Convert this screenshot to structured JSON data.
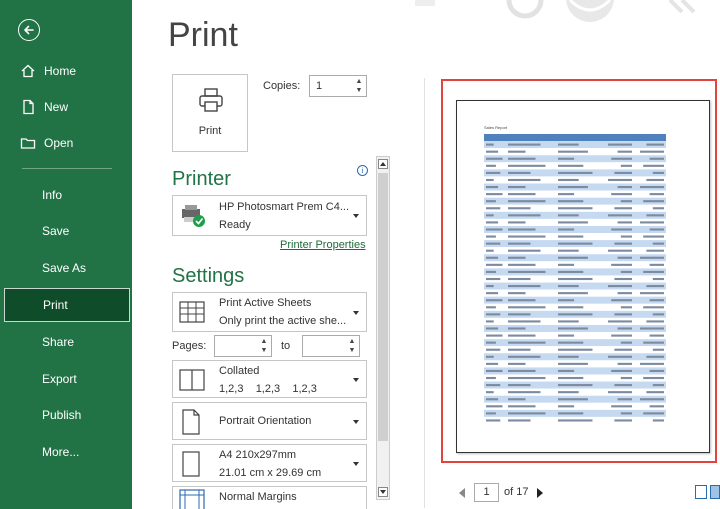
{
  "sidebar": {
    "items": [
      {
        "key": "home",
        "label": "Home"
      },
      {
        "key": "new",
        "label": "New"
      },
      {
        "key": "open",
        "label": "Open"
      },
      {
        "key": "info",
        "label": "Info"
      },
      {
        "key": "save",
        "label": "Save"
      },
      {
        "key": "save-as",
        "label": "Save As"
      },
      {
        "key": "print",
        "label": "Print",
        "active": true
      },
      {
        "key": "share",
        "label": "Share"
      },
      {
        "key": "export",
        "label": "Export"
      },
      {
        "key": "publish",
        "label": "Publish"
      },
      {
        "key": "more",
        "label": "More..."
      }
    ]
  },
  "page_title": "Print",
  "print_button": {
    "label": "Print"
  },
  "copies": {
    "label": "Copies:",
    "value": "1"
  },
  "printer": {
    "section_title": "Printer",
    "name": "HP Photosmart Prem C4...",
    "status": "Ready",
    "properties_link": "Printer Properties"
  },
  "settings": {
    "section_title": "Settings",
    "print_what": {
      "title": "Print Active Sheets",
      "subtitle": "Only print the active she..."
    },
    "pages": {
      "label": "Pages:",
      "to_label": "to",
      "from": "",
      "to": ""
    },
    "collation": {
      "title": "Collated",
      "subtitle": "1,2,3    1,2,3    1,2,3"
    },
    "orientation": {
      "title": "Portrait Orientation"
    },
    "paper": {
      "title": "A4 210x297mm",
      "subtitle": "21.01 cm x 29.69 cm"
    },
    "margins": {
      "title": "Normal Margins"
    }
  },
  "preview": {
    "page_heading": "Sales Report",
    "current_page": "1",
    "total_pages_label": "of 17",
    "table_rows": 40
  },
  "colors": {
    "sidebar_bg": "#217346",
    "sidebar_active_bg": "#0f4d2a",
    "accent": "#217346",
    "highlight_frame": "#e0443a",
    "table_header": "#4f81bd",
    "table_alt_row": "#c5d9f1"
  },
  "icons": {
    "back": "back-arrow-icon",
    "home": "home-icon",
    "new": "new-document-icon",
    "open": "open-folder-icon",
    "print": "printer-icon",
    "printer_status": "printer-ready-icon",
    "info": "info-icon",
    "print_what": "sheet-grid-icon",
    "collated": "collated-pages-icon",
    "orientation": "portrait-page-icon",
    "paper": "paper-size-icon",
    "margins": "margins-icon"
  }
}
